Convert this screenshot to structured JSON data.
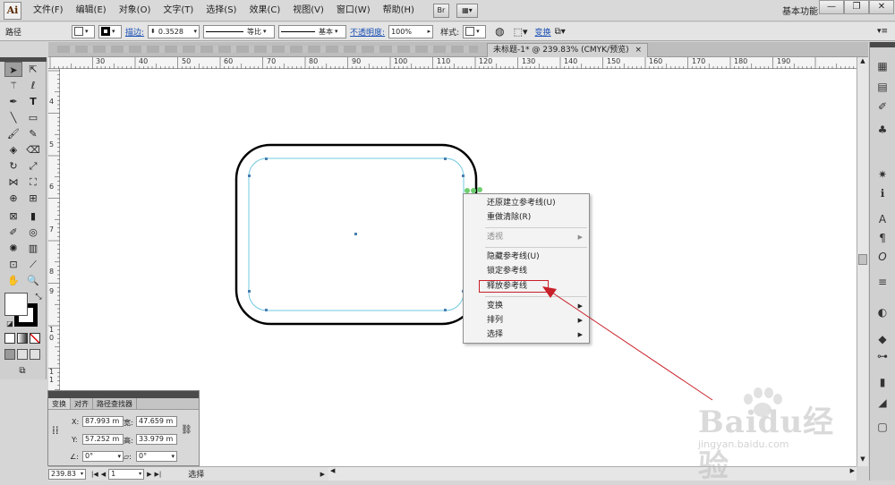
{
  "app": {
    "logo": "Ai",
    "workspace": "基本功能"
  },
  "menu": [
    "文件(F)",
    "编辑(E)",
    "对象(O)",
    "文字(T)",
    "选择(S)",
    "效果(C)",
    "视图(V)",
    "窗口(W)",
    "帮助(H)"
  ],
  "menubar_buttons": {
    "bridge": "Br"
  },
  "window_controls": {
    "minimize": "—",
    "restore": "❐",
    "close": "✕"
  },
  "control_bar": {
    "object_label": "路径",
    "stroke_link": "描边:",
    "stroke_weight": "0.3528",
    "profile_label": "等比",
    "brush_label": "基本",
    "opacity_link": "不透明度:",
    "opacity_value": "100%",
    "style_label": "样式:",
    "transform_link": "变换"
  },
  "document_tab": {
    "title": "未标题-1* @ 239.83% (CMYK/预览)",
    "close": "×"
  },
  "ruler": {
    "h_labels": [
      "30",
      "40",
      "50",
      "60",
      "70",
      "80",
      "90",
      "100",
      "110",
      "120",
      "130",
      "140",
      "150",
      "160",
      "170",
      "180",
      "190"
    ],
    "v_labels": [
      "4",
      "5",
      "6",
      "7",
      "8",
      "9",
      "1 0",
      "1 1",
      "1 2"
    ]
  },
  "context_menu": {
    "items": [
      {
        "label": "还原建立参考线(U)",
        "disabled": false,
        "submenu": false
      },
      {
        "label": "重做清除(R)",
        "disabled": false,
        "submenu": false
      },
      {
        "label": "透视",
        "disabled": true,
        "submenu": true
      },
      {
        "label": "隐藏参考线(U)",
        "disabled": false,
        "submenu": false
      },
      {
        "label": "锁定参考线",
        "disabled": false,
        "submenu": false
      },
      {
        "label": "释放参考线",
        "disabled": false,
        "submenu": false
      },
      {
        "label": "变换",
        "disabled": false,
        "submenu": true
      },
      {
        "label": "排列",
        "disabled": false,
        "submenu": true
      },
      {
        "label": "选择",
        "disabled": false,
        "submenu": true
      }
    ]
  },
  "transform_panel": {
    "tabs": [
      "变换",
      "对齐",
      "路径查找器"
    ],
    "x_label": "X:",
    "x_value": "87.993 m",
    "y_label": "Y:",
    "y_value": "57.252 m",
    "w_label": "宽:",
    "w_value": "47.659 m",
    "h_label": "高:",
    "h_value": "33.979 m",
    "rotate_value": "0°",
    "shear_value": "0°"
  },
  "status_bar": {
    "zoom": "239.83",
    "page": "1",
    "tool": "选择"
  },
  "watermark": {
    "main": "Baidu经验",
    "sub": "jingyan.baidu.com"
  },
  "colors": {
    "guide": "#72c8e0",
    "highlight": "#c8202a",
    "arrow": "#c8202a",
    "link": "#1a4fb5"
  }
}
